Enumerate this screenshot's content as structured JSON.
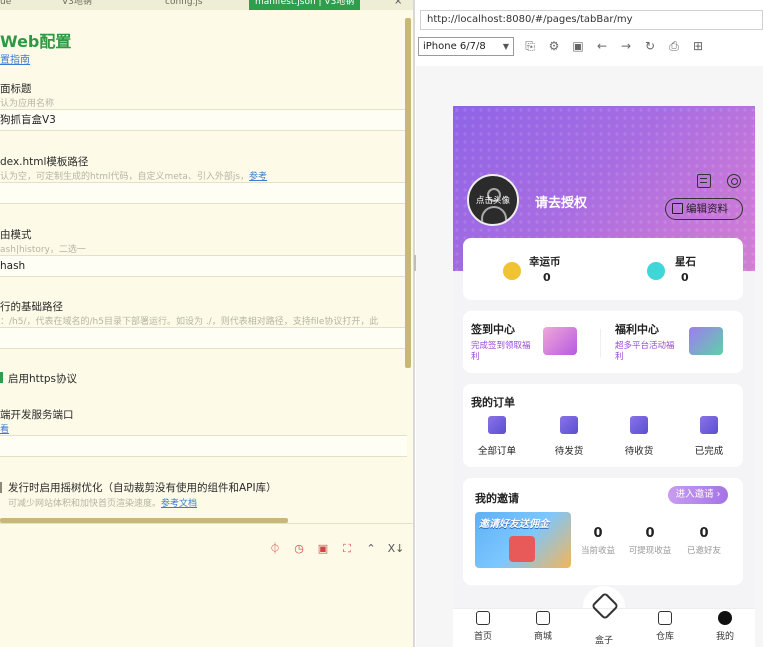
{
  "editor": {
    "tabs": [
      {
        "label": "ue"
      },
      {
        "label": "V3地钠"
      },
      {
        "label": "config.js"
      },
      {
        "label": "manifest.json | V3地钠"
      }
    ],
    "tab_close": "×",
    "section_title": "Web配置",
    "section_link": "置指南",
    "fields": [
      {
        "label": "面标题",
        "hint": "认为应用名称",
        "value": "狗抓盲盒V3"
      },
      {
        "label": "dex.html模板路径",
        "hint": "认为空，可定制生成的html代码，自定义meta、引入外部js，",
        "hint_link": "参考",
        "value": ""
      },
      {
        "label": "由模式",
        "hint": "ash|history，二选一",
        "value": "hash"
      },
      {
        "label": "行的基础路径",
        "hint": "：/h5/，代表在域名的/h5目录下部署运行。如设为 ./，则代表相对路径，支持file协议打开，此",
        "value": ""
      }
    ],
    "https_label": "启用https协议",
    "devserver": {
      "label": "端开发服务端口",
      "hint_link": "看"
    },
    "treeshake": {
      "label": "发行时启用摇树优化（自动裁剪没有使用的组件和API库）",
      "hint": "可减少网站体积和加快首页渲染速度。",
      "hint_link": "参考文档"
    },
    "toolbar_icons": [
      "share-icon",
      "clock-icon",
      "stop-icon",
      "image-icon",
      "collapse-icon",
      "pin-icon"
    ],
    "toolbar_glyphs": [
      "⏀",
      "◷",
      "▣",
      "⛶",
      "⌃",
      "X↓"
    ]
  },
  "browser": {
    "url": "http://localhost:8080/#/pages/tabBar/my",
    "device": "iPhone 6/7/8",
    "toolbar_glyphs": [
      "⎘",
      "⚙",
      "▣",
      "←",
      "→",
      "↻",
      "⎙",
      "⊞"
    ]
  },
  "app": {
    "avatar_text": "点击头像",
    "login_text": "请去授权",
    "edit_profile": "编辑资料",
    "coins": [
      {
        "label": "幸运币",
        "value": "0",
        "color": "#f1c232"
      },
      {
        "label": "星石",
        "value": "0",
        "color": "#3fd6d8"
      }
    ],
    "centers": [
      {
        "title": "签到中心",
        "sub": "完成签到领取福利"
      },
      {
        "title": "福利中心",
        "sub": "超多平台活动福利"
      }
    ],
    "orders_title": "我的订单",
    "orders": [
      {
        "label": "全部订单"
      },
      {
        "label": "待发货"
      },
      {
        "label": "待收货"
      },
      {
        "label": "已完成"
      }
    ],
    "invite_title": "我的邀请",
    "invite_button": "进入邀请 ›",
    "invite_banner": "邀请好友送佣金",
    "invite_stats": [
      {
        "value": "0",
        "label": "当前收益"
      },
      {
        "value": "0",
        "label": "可提现收益"
      },
      {
        "value": "0",
        "label": "已邀好友"
      }
    ],
    "tabbar": [
      {
        "label": "首页"
      },
      {
        "label": "商城"
      },
      {
        "label": "盒子"
      },
      {
        "label": "仓库"
      },
      {
        "label": "我的"
      }
    ]
  }
}
